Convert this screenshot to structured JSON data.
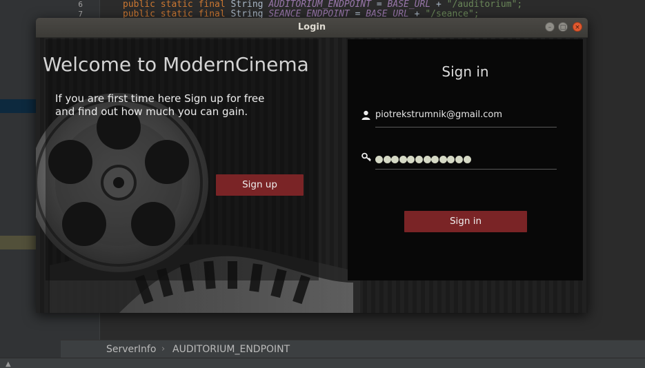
{
  "ide": {
    "line_numbers": [
      "6",
      "7"
    ],
    "code_lines": [
      {
        "kw": "public static final ",
        "type": "String ",
        "const": "AUDITORIUM_ENDPOINT",
        "op": " = ",
        "const2": "BASE_URL",
        "op2": " + ",
        "str": "\"/auditorium\";"
      },
      {
        "kw": "public static final ",
        "type": "String ",
        "const": "SEANCE_ENDPOINT",
        "op": " = ",
        "const2": "BASE_URL",
        "op2": " + ",
        "str": "\"/seance\";"
      }
    ],
    "breadcrumb": {
      "class_name": "ServerInfo",
      "separator": "›",
      "field_name": "AUDITORIUM_ENDPOINT"
    }
  },
  "window": {
    "title": "Login",
    "controls": {
      "minimize": "–",
      "maximize": "□",
      "close": "×"
    }
  },
  "welcome": {
    "title": "Welcome to ModernCinema",
    "text_line1": "If you are first time here Sign up for free",
    "text_line2": "and find out how much you can gain.",
    "signup_label": "Sign up"
  },
  "signin": {
    "title": "Sign in",
    "email_value": "piotrekstrumnik@gmail.com",
    "password_length": 12,
    "signin_label": "Sign in"
  },
  "colors": {
    "button": "#7a2426",
    "close_button": "#e0592f",
    "password_dot": "#d5d9c5"
  },
  "icons": {
    "email": "user-icon",
    "password": "key-icon"
  }
}
